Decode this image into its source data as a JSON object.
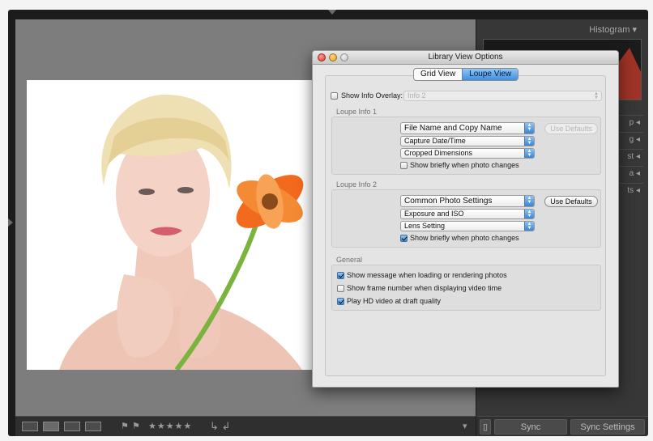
{
  "lightroom": {
    "histogram_label": "Histogram",
    "panel_tabs": [
      "p",
      "g",
      "st",
      "a",
      "ts"
    ],
    "sync_label": "Sync",
    "sync_settings_label": "Sync Settings",
    "toolbar_stars": "★★★★★",
    "toolbar_arrows": "↳ ↲"
  },
  "dialog": {
    "title": "Library View Options",
    "tabs": [
      {
        "label": "Grid View",
        "active": false
      },
      {
        "label": "Loupe View",
        "active": true
      }
    ],
    "show_info_overlay": {
      "label": "Show Info Overlay:",
      "checked": false,
      "value": "Info 2"
    },
    "loupe_info_1": {
      "title": "Loupe Info 1",
      "field1": "File Name and Copy Name",
      "field2": "Capture Date/Time",
      "field3": "Cropped Dimensions",
      "use_defaults": "Use Defaults",
      "show_briefly": {
        "label": "Show briefly when photo changes",
        "checked": false
      }
    },
    "loupe_info_2": {
      "title": "Loupe Info 2",
      "field1": "Common Photo Settings",
      "field2": "Exposure and ISO",
      "field3": "Lens Setting",
      "use_defaults": "Use Defaults",
      "show_briefly": {
        "label": "Show briefly when photo changes",
        "checked": true
      }
    },
    "general": {
      "title": "General",
      "options": [
        {
          "label": "Show message when loading or rendering photos",
          "checked": true
        },
        {
          "label": "Show frame number when displaying video time",
          "checked": false
        },
        {
          "label": "Play HD video at draft quality",
          "checked": true
        }
      ]
    }
  },
  "colors": {
    "accent_blue": "#3d8fe0",
    "app_background": "#1c1c1c",
    "canvas_grey": "#7d7d7d"
  }
}
